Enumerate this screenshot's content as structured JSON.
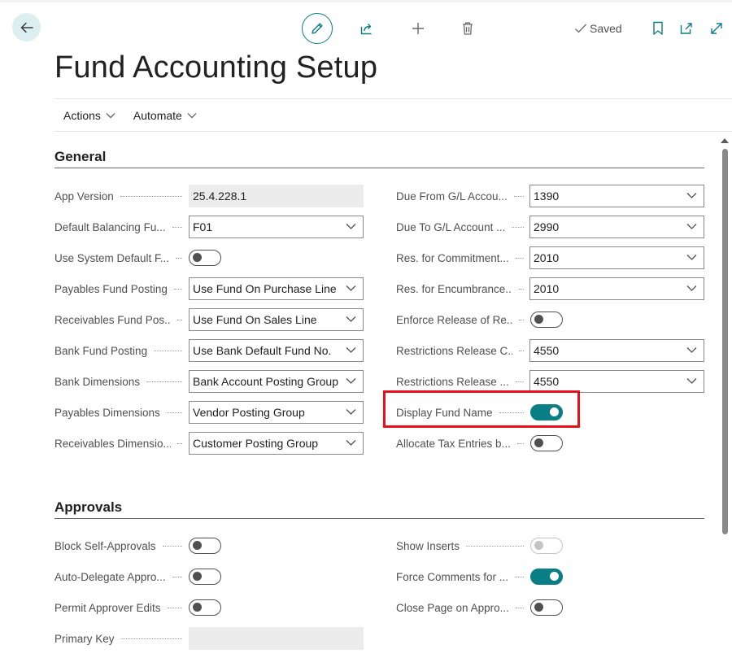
{
  "header": {
    "saved_label": "Saved",
    "title": "Fund Accounting Setup",
    "icons": [
      "back-arrow-icon",
      "edit-pencil-icon",
      "share-icon",
      "add-plus-icon",
      "delete-trash-icon",
      "checkmark-icon",
      "bookmark-icon",
      "open-new-window-icon",
      "expand-icon"
    ]
  },
  "actions": [
    {
      "label": "Actions"
    },
    {
      "label": "Automate"
    }
  ],
  "sections": {
    "general": "General",
    "approvals": "Approvals"
  },
  "general_left": [
    {
      "label": "App Version",
      "value": "25.4.228.1"
    },
    {
      "label": "Default Balancing Fu...",
      "value": "F01"
    },
    {
      "label": "Use System Default F...",
      "toggle": "off"
    },
    {
      "label": "Payables Fund Posting",
      "value": "Use Fund On Purchase Line"
    },
    {
      "label": "Receivables Fund Pos...",
      "value": "Use Fund On Sales Line"
    },
    {
      "label": "Bank Fund Posting",
      "value": "Use Bank Default Fund No."
    },
    {
      "label": "Bank Dimensions",
      "value": "Bank Account Posting Group"
    },
    {
      "label": "Payables Dimensions",
      "value": "Vendor Posting Group"
    },
    {
      "label": "Receivables Dimensio...",
      "value": "Customer Posting Group"
    }
  ],
  "general_right": [
    {
      "label": "Due From G/L Accou...",
      "value": "1390"
    },
    {
      "label": "Due To G/L Account ...",
      "value": "2990"
    },
    {
      "label": "Res. for Commitment...",
      "value": "2010"
    },
    {
      "label": "Res. for Encumbrance...",
      "value": "2010"
    },
    {
      "label": "Enforce Release of Re...",
      "toggle": "off"
    },
    {
      "label": "Restrictions Release C...",
      "value": "4550"
    },
    {
      "label": "Restrictions Release ...",
      "value": "4550"
    },
    {
      "label": "Display Fund Name",
      "toggle": "on"
    },
    {
      "label": "Allocate Tax Entries b...",
      "toggle": "off"
    }
  ],
  "approvals_left": [
    {
      "label": "Block Self-Approvals",
      "toggle": "off"
    },
    {
      "label": "Auto-Delegate Appro...",
      "toggle": "off"
    },
    {
      "label": "Permit Approver Edits",
      "toggle": "off"
    },
    {
      "label": "Primary Key",
      "value": ""
    }
  ],
  "approvals_right": [
    {
      "label": "Show Inserts",
      "toggle": "disabled"
    },
    {
      "label": "Force Comments for ...",
      "toggle": "on"
    },
    {
      "label": "Close Page on Appro...",
      "toggle": "off"
    }
  ],
  "colors": {
    "accent": "#0a7e85",
    "highlight": "#e8101b"
  }
}
